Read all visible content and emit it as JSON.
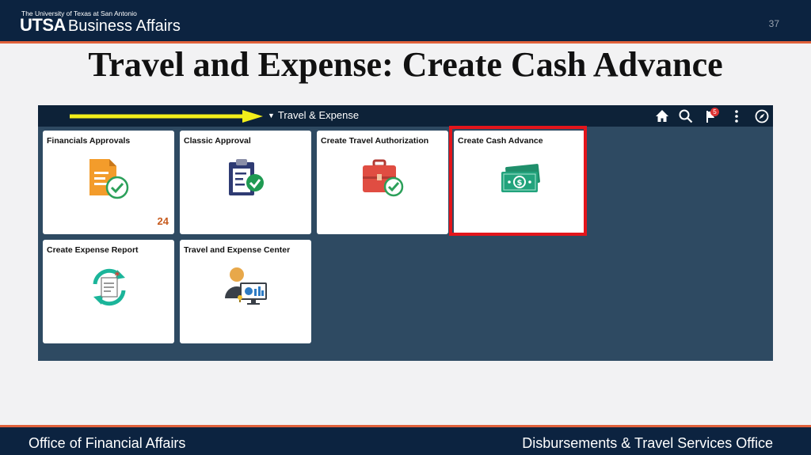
{
  "header": {
    "university": "The University of Texas at San Antonio",
    "logo_utsa": "UTSA",
    "logo_unit": "Business Affairs",
    "slide_number": "37"
  },
  "title": "Travel and Expense: Create Cash Advance",
  "app": {
    "nav_title": "Travel & Expense",
    "caret": "▼",
    "notification_count": "5",
    "icons": [
      "home-icon",
      "search-icon",
      "flag-icon",
      "more-icon",
      "compass-icon"
    ]
  },
  "tiles": [
    {
      "label": "Financials Approvals",
      "count": "24",
      "icon": "clipboard-check-icon"
    },
    {
      "label": "Classic Approval",
      "icon": "clipboard-approve-icon"
    },
    {
      "label": "Create Travel Authorization",
      "icon": "briefcase-check-icon"
    },
    {
      "label": "Create Cash Advance",
      "icon": "money-icon"
    },
    {
      "label": "Create Expense Report",
      "icon": "refresh-document-icon"
    },
    {
      "label": "Travel and Expense Center",
      "icon": "person-monitor-icon"
    }
  ],
  "footer": {
    "left": "Office of Financial Affairs",
    "right": "Disbursements & Travel Services Office"
  },
  "colors": {
    "brand_navy": "#0c2340",
    "accent_orange": "#e0613a",
    "highlight_red": "#e3151b",
    "annotation_yellow": "#f2ee1a"
  }
}
